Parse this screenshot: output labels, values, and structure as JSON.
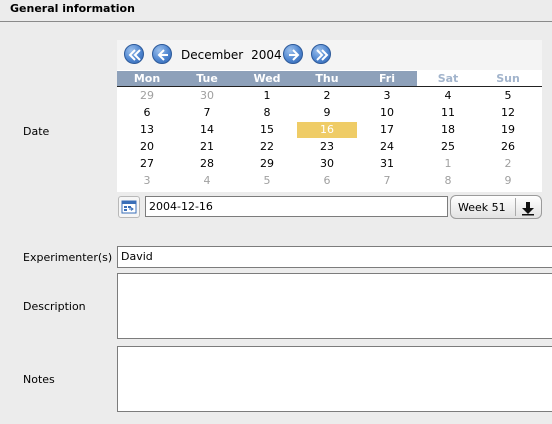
{
  "section": {
    "title": "General information"
  },
  "labels": {
    "date": "Date",
    "experimenters": "Experimenter(s)",
    "description": "Description",
    "notes": "Notes"
  },
  "calendar": {
    "month": "December",
    "year": "2004",
    "weekdays": [
      "Mon",
      "Tue",
      "Wed",
      "Thu",
      "Fri",
      "Sat",
      "Sun"
    ],
    "weeks": [
      [
        {
          "d": "29",
          "other": true
        },
        {
          "d": "30",
          "other": true
        },
        {
          "d": "1"
        },
        {
          "d": "2"
        },
        {
          "d": "3"
        },
        {
          "d": "4"
        },
        {
          "d": "5"
        }
      ],
      [
        {
          "d": "6"
        },
        {
          "d": "7"
        },
        {
          "d": "8"
        },
        {
          "d": "9"
        },
        {
          "d": "10"
        },
        {
          "d": "11"
        },
        {
          "d": "12"
        }
      ],
      [
        {
          "d": "13"
        },
        {
          "d": "14"
        },
        {
          "d": "15"
        },
        {
          "d": "16",
          "selected": true
        },
        {
          "d": "17"
        },
        {
          "d": "18"
        },
        {
          "d": "19"
        }
      ],
      [
        {
          "d": "20"
        },
        {
          "d": "21"
        },
        {
          "d": "22"
        },
        {
          "d": "23"
        },
        {
          "d": "24"
        },
        {
          "d": "25"
        },
        {
          "d": "26"
        }
      ],
      [
        {
          "d": "27"
        },
        {
          "d": "28"
        },
        {
          "d": "29"
        },
        {
          "d": "30"
        },
        {
          "d": "31"
        },
        {
          "d": "1",
          "other": true
        },
        {
          "d": "2",
          "other": true
        }
      ],
      [
        {
          "d": "3",
          "other": true
        },
        {
          "d": "4",
          "other": true
        },
        {
          "d": "5",
          "other": true
        },
        {
          "d": "6",
          "other": true
        },
        {
          "d": "7",
          "other": true
        },
        {
          "d": "8",
          "other": true
        },
        {
          "d": "9",
          "other": true
        }
      ]
    ],
    "selected_color": "#efcc66",
    "weekday_header_color": "#8ea1ba",
    "weekend_header_color": "#a2b4cc"
  },
  "date_field": {
    "value": "2004-12-16"
  },
  "week_selector": {
    "label": "Week 51"
  },
  "fields": {
    "experimenters": "David",
    "description": "",
    "notes": ""
  },
  "icons": {
    "prev_year": "double-chevron-left-icon",
    "prev_month": "chevron-left-icon",
    "next_month": "chevron-right-icon",
    "next_year": "double-chevron-right-icon",
    "calendar_button": "calendar-icon",
    "week_dropdown": "arrow-down-icon"
  }
}
